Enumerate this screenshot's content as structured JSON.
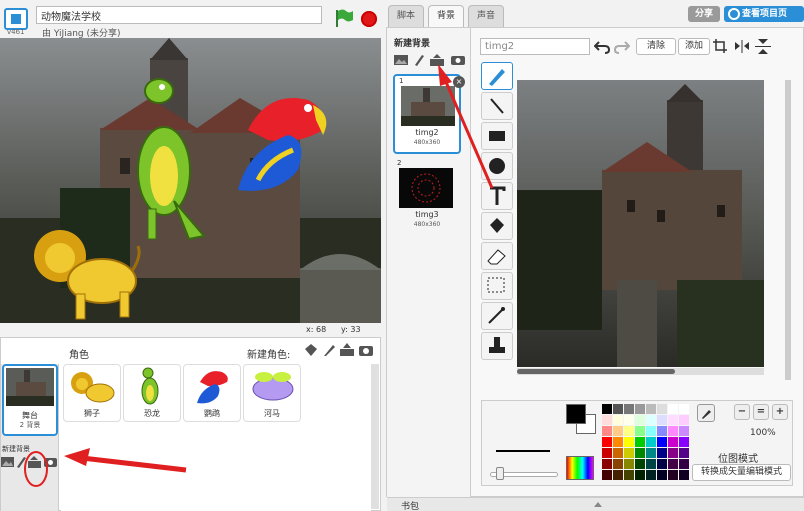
{
  "header": {
    "version": "v461",
    "project_title": "动物魔法学校",
    "byline": "由 YiJiang (未分享)"
  },
  "stage": {
    "coords_x_label": "x: 68",
    "coords_y_label": "y: 33"
  },
  "sprites_panel": {
    "title": "角色",
    "new_sprite_label": "新建角色:",
    "stage_label": "舞台",
    "stage_sub": "2 背景",
    "new_backdrop_label": "新建背景",
    "sprites": [
      {
        "name": "狮子",
        "icon": "lion"
      },
      {
        "name": "恐龙",
        "icon": "dinosaur"
      },
      {
        "name": "鹦鹉",
        "icon": "parrot"
      },
      {
        "name": "河马",
        "icon": "hippo"
      }
    ]
  },
  "tabs": [
    {
      "label": "脚本"
    },
    {
      "label": "背景"
    },
    {
      "label": "声音"
    }
  ],
  "top_buttons": {
    "share": "分享",
    "see_project": "查看项目页"
  },
  "backdrops": {
    "title": "新建背景",
    "items": [
      {
        "num": "1",
        "name": "timg2",
        "size": "480x360"
      },
      {
        "num": "2",
        "name": "timg3",
        "size": "480x360"
      }
    ]
  },
  "editor": {
    "name_value": "timg2",
    "clear_label": "清除",
    "add_label": "添加",
    "zoom_percent": "100%",
    "mode_label": "位图模式",
    "convert_label": "转换成矢量编辑模式"
  },
  "backpack": {
    "label": "书包"
  },
  "colors": {
    "accent": "#2a8fd6",
    "stop": "#e01818",
    "annotation": "#e02020"
  }
}
